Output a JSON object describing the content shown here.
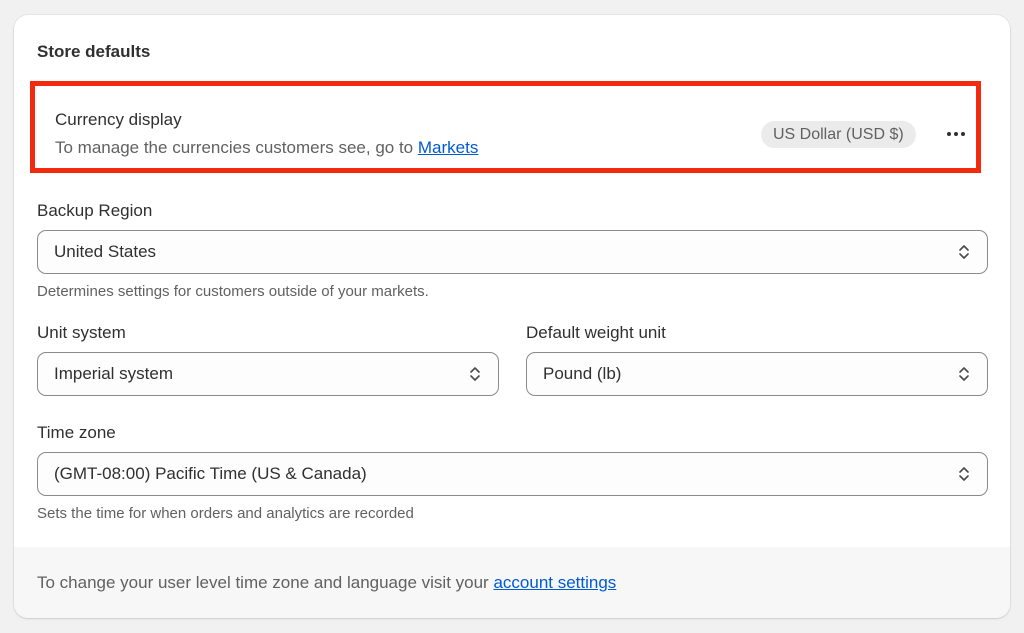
{
  "section": {
    "title": "Store defaults"
  },
  "currency": {
    "title": "Currency display",
    "description_prefix": "To manage the currencies customers see, go to",
    "description_link": "Markets",
    "badge": "US Dollar (USD $)",
    "more_icon": "more-horizontal-icon"
  },
  "backup_region": {
    "label": "Backup Region",
    "value": "United States",
    "help": "Determines settings for customers outside of your markets."
  },
  "unit_system": {
    "label": "Unit system",
    "value": "Imperial system"
  },
  "weight_unit": {
    "label": "Default weight unit",
    "value": "Pound (lb)"
  },
  "time_zone": {
    "label": "Time zone",
    "value": "(GMT-08:00) Pacific Time (US & Canada)",
    "help": "Sets the time for when orders and analytics are recorded"
  },
  "footer": {
    "text_prefix": "To change your user level time zone and language visit your",
    "link": "account settings"
  },
  "colors": {
    "highlight_border": "#f42a0f",
    "link": "#005bd3"
  }
}
